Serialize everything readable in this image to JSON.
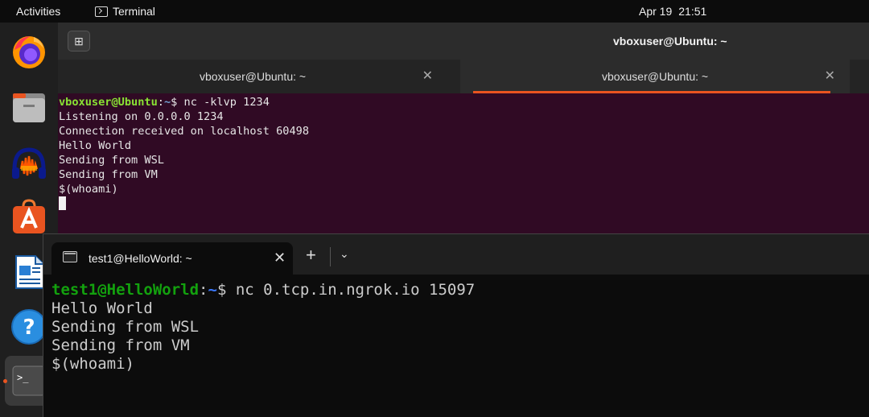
{
  "topbar": {
    "activities": "Activities",
    "app_name": "Terminal",
    "date": "Apr 19",
    "time": "21:51"
  },
  "dock": {
    "items": [
      "firefox-icon",
      "files-icon",
      "audacity-icon",
      "app-center-icon",
      "libreoffice-writer-icon",
      "help-icon",
      "terminal-icon"
    ]
  },
  "ubuntu_terminal": {
    "window_title": "vboxuser@Ubuntu: ~",
    "tabs": [
      {
        "label": "vboxuser@Ubuntu: ~",
        "active": false
      },
      {
        "label": "vboxuser@Ubuntu: ~",
        "active": true
      }
    ],
    "prompt_user": "vboxuser@Ubuntu",
    "prompt_sep": ":",
    "prompt_path": "~",
    "prompt_symbol": "$ ",
    "command": "nc -klvp 1234",
    "output": [
      "Listening on 0.0.0.0 1234",
      "Connection received on localhost 60498",
      "Hello World",
      "Sending from WSL",
      "Sending from VM",
      "$(whoami)"
    ]
  },
  "windows_terminal": {
    "tab_label": "test1@HelloWorld: ~",
    "prompt_user": "test1@HelloWorld",
    "prompt_sep": ":",
    "prompt_path": "~",
    "prompt_symbol": "$ ",
    "command": "nc 0.tcp.in.ngrok.io 15097",
    "output": [
      "Hello World",
      "Sending from WSL",
      "Sending from VM",
      "$(whoami)"
    ]
  },
  "colors": {
    "ubuntu_orange": "#e95420",
    "ubuntu_terminal_bg": "#300a24",
    "wt_bg": "#0c0c0c"
  }
}
